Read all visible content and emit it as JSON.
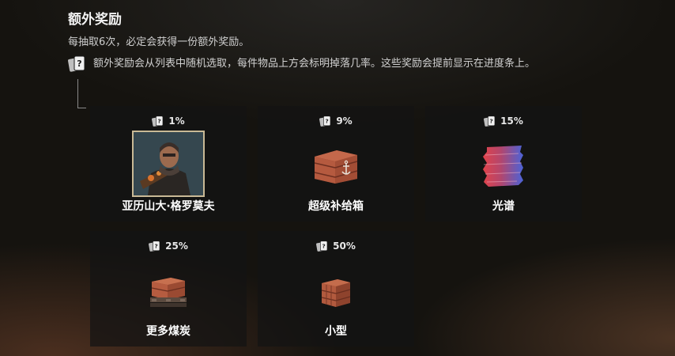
{
  "header": {
    "title": "额外奖励",
    "subtitle": "每抽取6次，必定会获得一份额外奖励。",
    "note": "额外奖励会从列表中随机选取，每件物品上方会标明掉落几率。这些奖励会提前显示在进度条上。"
  },
  "rewards": [
    {
      "chance": "1%",
      "label": "亚历山大·格罗莫夫",
      "icon": "character-portrait"
    },
    {
      "chance": "9%",
      "label": "超级补给箱",
      "icon": "supply-crate-icon"
    },
    {
      "chance": "15%",
      "label": "光谱",
      "icon": "spectrum-paint-icon"
    },
    {
      "chance": "25%",
      "label": "更多煤炭",
      "icon": "coal-crates-icon"
    },
    {
      "chance": "50%",
      "label": "小型",
      "icon": "small-crate-icon"
    }
  ],
  "colors": {
    "portrait_frame": "#c9b995",
    "crate_red": "#b25a3e",
    "spectrum_red": "#e0434a",
    "spectrum_blue": "#4b63d8"
  }
}
